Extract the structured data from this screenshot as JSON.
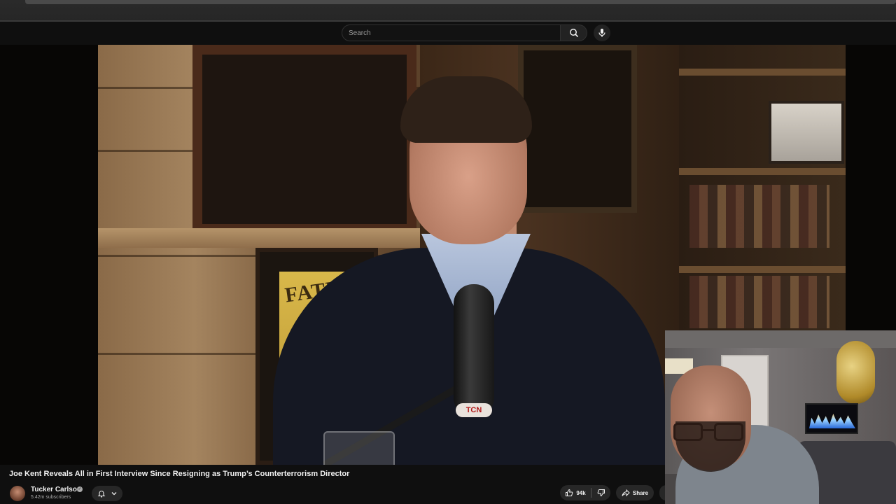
{
  "masthead": {
    "search": {
      "placeholder": "Search"
    }
  },
  "video": {
    "poster_text": "FATH",
    "mic_brand": "TCN",
    "title": "Joe Kent Reveals All in First Interview Since Resigning as Trump’s Counterterrorism Director"
  },
  "channel": {
    "name": "Tucker Carlson",
    "subscribers": "5.42m subscribers"
  },
  "actions": {
    "like_count": "94k",
    "share_label": "Share"
  },
  "icons": {
    "search": "search-icon",
    "mic": "microphone-icon",
    "bell": "bell-icon",
    "chevron": "chevron-down-icon",
    "like": "thumbs-up-icon",
    "dislike": "thumbs-down-icon",
    "share": "share-arrow-icon",
    "verified": "verified-check-icon"
  },
  "colors": {
    "background": "#0f0f0f",
    "button_bg": "#272727",
    "text": "#f1f1f1",
    "muted_text": "#aaaaaa"
  }
}
